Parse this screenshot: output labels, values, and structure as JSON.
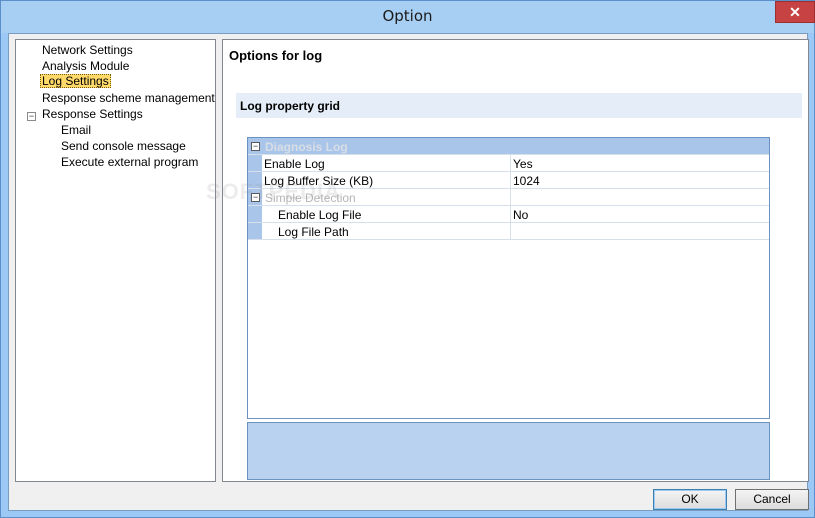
{
  "window": {
    "title": "Option",
    "close_glyph": "✕"
  },
  "tree": {
    "items": [
      {
        "label": "Network Settings"
      },
      {
        "label": "Analysis Module"
      },
      {
        "label": "Log Settings"
      },
      {
        "label": "Response scheme management"
      },
      {
        "label": "Response Settings"
      },
      {
        "label": "Email"
      },
      {
        "label": "Send console message"
      },
      {
        "label": "Execute external program"
      }
    ],
    "expander_glyph": "−"
  },
  "panel": {
    "title": "Options for log",
    "section": "Log property grid"
  },
  "grid": {
    "category": "Diagnosis Log",
    "subcategory": "Simple Detection",
    "toggle_glyph": "−",
    "rows": [
      {
        "name": "Enable Log",
        "value": "Yes"
      },
      {
        "name": "Log Buffer Size (KB)",
        "value": "1024"
      },
      {
        "name": "Enable Log File",
        "value": "No"
      },
      {
        "name": "Log File Path",
        "value": ""
      }
    ]
  },
  "buttons": {
    "ok": "OK",
    "cancel": "Cancel"
  },
  "watermark": "SOFTPEDIA"
}
